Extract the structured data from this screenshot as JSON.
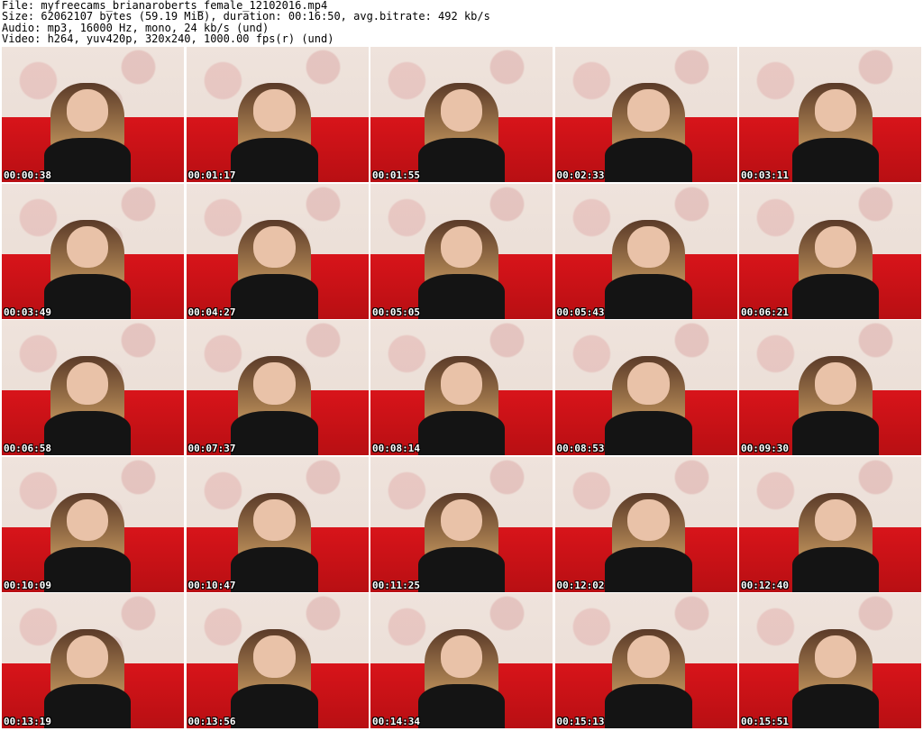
{
  "header": {
    "file": "File: myfreecams_brianaroberts_female_12102016.mp4",
    "size": "Size: 62062107 bytes (59.19 MiB), duration: 00:16:50, avg.bitrate: 492 kb/s",
    "audio": "Audio: mp3, 16000 Hz, mono, 24 kb/s (und)",
    "video": "Video: h264, yuv420p, 320x240, 1000.00 fps(r) (und)"
  },
  "thumbnails": [
    {
      "time": "00:00:38"
    },
    {
      "time": "00:01:17"
    },
    {
      "time": "00:01:55"
    },
    {
      "time": "00:02:33"
    },
    {
      "time": "00:03:11"
    },
    {
      "time": "00:03:49"
    },
    {
      "time": "00:04:27"
    },
    {
      "time": "00:05:05"
    },
    {
      "time": "00:05:43"
    },
    {
      "time": "00:06:21"
    },
    {
      "time": "00:06:58"
    },
    {
      "time": "00:07:37"
    },
    {
      "time": "00:08:14"
    },
    {
      "time": "00:08:53"
    },
    {
      "time": "00:09:30"
    },
    {
      "time": "00:10:09"
    },
    {
      "time": "00:10:47"
    },
    {
      "time": "00:11:25"
    },
    {
      "time": "00:12:02"
    },
    {
      "time": "00:12:40"
    },
    {
      "time": "00:13:19"
    },
    {
      "time": "00:13:56"
    },
    {
      "time": "00:14:34"
    },
    {
      "time": "00:15:13"
    },
    {
      "time": "00:15:51"
    }
  ]
}
